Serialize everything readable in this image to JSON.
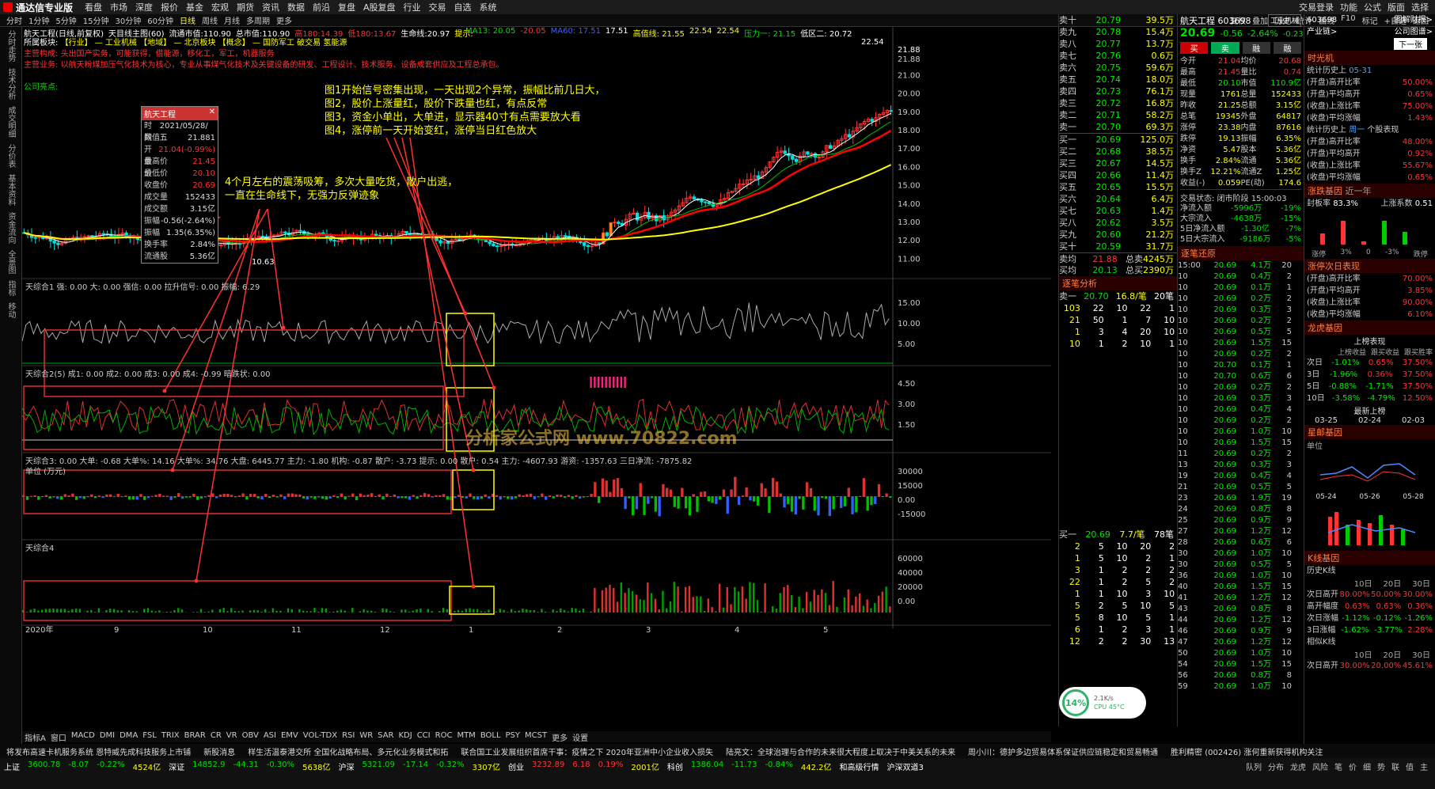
{
  "window": {
    "app_name": "通达信专业版",
    "menu": [
      "看盘",
      "市场",
      "深度",
      "报价",
      "基金",
      "宏观",
      "期货",
      "资讯",
      "数据",
      "前沿",
      "复盘",
      "A股复盘",
      "行业",
      "交易",
      "自选",
      "系统"
    ],
    "right_items": [
      "交易登录",
      "功能",
      "公式",
      "版面",
      "选择"
    ]
  },
  "toolbar": {
    "periods": [
      "分时",
      "1分钟",
      "5分钟",
      "15分钟",
      "30分钟",
      "60分钟",
      "日线",
      "周线",
      "月线",
      "多周期",
      "更多"
    ],
    "right_buttons": [
      "复权",
      "叠加",
      "历史",
      "统计",
      "画线",
      "F10",
      "标记",
      "+自选",
      "返回"
    ]
  },
  "leftbar": [
    "分时走势",
    "技术分析",
    "成交明细",
    "分价表",
    "基本资料",
    "资金流向",
    "全景图",
    "指标",
    "移动"
  ],
  "chart_header": {
    "title": "航天工程(日线,前复权)",
    "ma_line": "天目线主图(60)",
    "circ": "流通市值:110.90",
    "total": "总市值:110.90",
    "high": "高180:14.39",
    "low": "低180:13.67",
    "life": "生命线:20.97",
    "hint": "提示:",
    "ma13": "MA13: 20.05",
    "ma20": "-20.05",
    "ma60": "MA60: 17.51",
    "ma5": "17.51",
    "hi2": "高值线: 21.55",
    "v2": "22.54",
    "v3": "22.54",
    "small1": "压力一: 21.15",
    "small2": "低区二: 20.72"
  },
  "stock_info": {
    "sector_label": "所属板块:",
    "sector": "【行业】 — 工业机械   【地域】 — 北京板块   【概念】 — 国防军工 破交易 氢能源",
    "main_label": "主营构成:",
    "main": "头出国产实务，可能获得，借能源，移化工，军工，机器服务",
    "biz_label": "主营业务:",
    "biz": "以航天粉煤加压气化技术为核心，专业从事煤气化技术及关键设备的研发、工程设计、技术服务、设备成套供应及工程总承包。",
    "company_label": "公司亮点:"
  },
  "price_axis": [
    "21.88",
    "21.00",
    "20.00",
    "19.00",
    "18.00",
    "17.00",
    "16.00",
    "15.00",
    "14.00",
    "13.00",
    "12.00",
    "11.00"
  ],
  "top_right_price": "21.88",
  "max_label": "22.54",
  "low_label": "10.63",
  "popup": {
    "title": "航天工程",
    "rows": [
      [
        "时间",
        "2021/05/28/五"
      ],
      [
        "数值",
        "21.881"
      ],
      [
        "开盘价",
        "21.04(-0.99%)"
      ],
      [
        "最高价",
        "21.45"
      ],
      [
        "最低价",
        "20.10"
      ],
      [
        "收盘价",
        "20.69"
      ],
      [
        "成交量",
        "152433"
      ],
      [
        "成交额",
        "3.15亿"
      ],
      [
        "振幅",
        "-0.56(-2.64%)"
      ],
      [
        "振幅",
        "1.35(6.35%)"
      ],
      [
        "换手率",
        "2.84%"
      ],
      [
        "流通股",
        "5.36亿"
      ]
    ]
  },
  "annotations": {
    "a1": [
      "图1开始信号密集出现，一天出现2个异常，振幅比前几日大，",
      "图2，股价上涨量红，股价下跌量也红，有点反常",
      "图3，资金小单出，大单进，显示器40寸有点需要放大看",
      "图4，涨停前一天开始变红，涨停当日红色放大"
    ],
    "a2": [
      "4个月左右的震荡吸筹，多次大量吃货，散户出逃，",
      "一直在生命线下，无强力反弹迹象"
    ]
  },
  "panels": {
    "p1": {
      "hdr": "天综合1 强: 0.00  大: 0.00  强信: 0.00  拉升信号: 0.00  振幅: 6.29",
      "axis": [
        "15.00",
        "10.00",
        "5.00"
      ]
    },
    "p2": {
      "hdr": "天综合2(5) 成1: 0.00  成2: 0.00  成3: 0.00  成4: -0.99  暗跌状: 0.00",
      "axis": [
        "4.50",
        "3.00",
        "1.50"
      ]
    },
    "p3": {
      "hdr": "天综合3: 0.00  大单: -0.68  大单%: 14.16  大单%: 34.76  大盘: 6445.77  主力: -1.80  机构: -0.87  散户: -3.73  提示: 0.00  散户: 0.54  主力: -4607.93  游资: -1357.63  三日净流: -7875.82",
      "unit": "单位 (万元)",
      "axis": [
        "30000",
        "15000",
        "0.00",
        "-15000"
      ]
    },
    "p4": {
      "hdr": "天综合4",
      "axis": [
        "60000",
        "40000",
        "20000",
        "0.00"
      ]
    }
  },
  "xaxis": [
    "2020年",
    "9",
    "10",
    "11",
    "12",
    "1",
    "2",
    "3",
    "4",
    "5"
  ],
  "bottom_tabs": [
    "指标A",
    "窗口",
    "MACD",
    "DMI",
    "DMA",
    "FSL",
    "TRIX",
    "BRAR",
    "CR",
    "VR",
    "OBV",
    "ASI",
    "EMV",
    "VOL-TDX",
    "RSI",
    "WR",
    "SAR",
    "KDJ",
    "CCI",
    "ROC",
    "MTM",
    "BOLL",
    "PSY",
    "MCST",
    "更多",
    "设置"
  ],
  "watermark": "分析家公式网 www.70822.com",
  "quote": {
    "sells": [
      [
        "卖十",
        "20.79",
        "39.5万"
      ],
      [
        "卖九",
        "20.78",
        "15.4万"
      ],
      [
        "卖八",
        "20.77",
        "13.7万"
      ],
      [
        "卖七",
        "20.76",
        "0.6万"
      ],
      [
        "卖六",
        "20.75",
        "59.6万"
      ],
      [
        "卖五",
        "20.74",
        "18.0万"
      ],
      [
        "卖四",
        "20.73",
        "76.1万"
      ],
      [
        "卖三",
        "20.72",
        "16.8万"
      ],
      [
        "卖二",
        "20.71",
        "58.2万"
      ],
      [
        "卖一",
        "20.70",
        "69.3万"
      ]
    ],
    "buys": [
      [
        "买一",
        "20.69",
        "125.0万"
      ],
      [
        "买二",
        "20.68",
        "38.5万"
      ],
      [
        "买三",
        "20.67",
        "14.5万"
      ],
      [
        "买四",
        "20.66",
        "11.4万"
      ],
      [
        "买五",
        "20.65",
        "15.5万"
      ],
      [
        "买六",
        "20.64",
        "6.4万"
      ],
      [
        "买七",
        "20.63",
        "1.4万"
      ],
      [
        "买八",
        "20.62",
        "3.5万"
      ],
      [
        "买九",
        "20.60",
        "21.2万"
      ],
      [
        "买十",
        "20.59",
        "31.7万"
      ]
    ],
    "avg_sell": [
      "卖均",
      "21.88",
      "总卖",
      "4245万"
    ],
    "avg_buy": [
      "买均",
      "20.13",
      "总买",
      "2390万"
    ],
    "sep_title": "逐笔分析",
    "sell1": [
      "卖一",
      "20.70",
      "16.8/笔",
      "20笔"
    ],
    "grid1": [
      [
        "103",
        "22",
        "10",
        "22",
        "1"
      ],
      [
        "21",
        "50",
        "1",
        "7",
        "10"
      ],
      [
        "1",
        "3",
        "4",
        "20",
        "10"
      ],
      [
        "10",
        "1",
        "2",
        "10",
        "1"
      ]
    ],
    "buy1": [
      "买一",
      "20.69",
      "7.7/笔",
      "78笔"
    ],
    "grid2": [
      [
        "2",
        "5",
        "10",
        "20",
        "2"
      ],
      [
        "1",
        "5",
        "10",
        "2",
        "1"
      ],
      [
        "3",
        "1",
        "2",
        "2",
        "2"
      ],
      [
        "22",
        "1",
        "2",
        "5",
        "2"
      ],
      [
        "1",
        "1",
        "10",
        "3",
        "10"
      ],
      [
        "5",
        "2",
        "5",
        "10",
        "5"
      ],
      [
        "5",
        "8",
        "10",
        "5",
        "1"
      ],
      [
        "6",
        "1",
        "2",
        "3",
        "1"
      ],
      [
        "12",
        "2",
        "2",
        "30",
        "13"
      ]
    ]
  },
  "ticks": {
    "title": "逐笔还原",
    "rows": [
      [
        "15:00",
        "20.69",
        "4.1万",
        "20"
      ],
      [
        "10",
        "20.69",
        "0.4万",
        "2"
      ],
      [
        "10",
        "20.69",
        "0.1万",
        "1"
      ],
      [
        "10",
        "20.69",
        "0.2万",
        "2"
      ],
      [
        "10",
        "20.69",
        "0.3万",
        "3"
      ],
      [
        "10",
        "20.69",
        "0.2万",
        "2"
      ],
      [
        "10",
        "20.69",
        "0.5万",
        "5"
      ],
      [
        "10",
        "20.69",
        "1.5万",
        "15"
      ],
      [
        "10",
        "20.69",
        "0.2万",
        "2"
      ],
      [
        "10",
        "20.70",
        "0.1万",
        "1"
      ],
      [
        "10",
        "20.70",
        "0.6万",
        "6"
      ],
      [
        "10",
        "20.69",
        "0.2万",
        "2"
      ],
      [
        "10",
        "20.69",
        "0.3万",
        "3"
      ],
      [
        "10",
        "20.69",
        "0.4万",
        "4"
      ],
      [
        "10",
        "20.69",
        "0.2万",
        "2"
      ],
      [
        "10",
        "20.69",
        "1.0万",
        "10"
      ],
      [
        "10",
        "20.69",
        "1.5万",
        "15"
      ],
      [
        "11",
        "20.69",
        "0.2万",
        "2"
      ],
      [
        "13",
        "20.69",
        "0.3万",
        "3"
      ],
      [
        "19",
        "20.69",
        "0.4万",
        "4"
      ],
      [
        "21",
        "20.69",
        "0.5万",
        "5"
      ],
      [
        "23",
        "20.69",
        "1.9万",
        "19"
      ],
      [
        "24",
        "20.69",
        "0.8万",
        "8"
      ],
      [
        "25",
        "20.69",
        "0.9万",
        "9"
      ],
      [
        "27",
        "20.69",
        "1.2万",
        "12"
      ],
      [
        "28",
        "20.69",
        "0.6万",
        "6"
      ],
      [
        "30",
        "20.69",
        "1.0万",
        "10"
      ],
      [
        "30",
        "20.69",
        "0.5万",
        "5"
      ],
      [
        "36",
        "20.69",
        "1.0万",
        "10"
      ],
      [
        "40",
        "20.69",
        "1.5万",
        "15"
      ],
      [
        "41",
        "20.69",
        "1.2万",
        "12"
      ],
      [
        "43",
        "20.69",
        "0.8万",
        "8"
      ],
      [
        "44",
        "20.69",
        "1.2万",
        "12"
      ],
      [
        "46",
        "20.69",
        "0.9万",
        "9"
      ],
      [
        "47",
        "20.69",
        "1.2万",
        "12"
      ],
      [
        "50",
        "20.69",
        "1.0万",
        "10"
      ],
      [
        "54",
        "20.69",
        "1.5万",
        "15"
      ],
      [
        "56",
        "20.69",
        "0.8万",
        "8"
      ],
      [
        "59",
        "20.69",
        "1.0万",
        "10"
      ]
    ]
  },
  "stockpanel": {
    "name": "航天工程 603698",
    "badge": "工业机械",
    "price": "20.69",
    "chg": "-0.56",
    "pct": "-2.64%",
    "pct2": "-0.23%",
    "btns": [
      "买",
      "卖",
      "融",
      "融"
    ],
    "rows": [
      [
        "今开",
        "21.04",
        "均价",
        "20.68"
      ],
      [
        "最高",
        "21.45",
        "量比",
        "0.74"
      ],
      [
        "最低",
        "20.10",
        "市值",
        "110.9亿"
      ],
      [
        "现量",
        "1761",
        "总量",
        "152433"
      ],
      [
        "昨收",
        "21.25",
        "总额",
        "3.15亿"
      ],
      [
        "总笔",
        "19345",
        "外盘",
        "64817"
      ],
      [
        "涨停",
        "23.38",
        "内盘",
        "87616"
      ],
      [
        "跌停",
        "19.13",
        "振幅",
        "6.35%"
      ],
      [
        "净资",
        "5.47",
        "股本",
        "5.36亿"
      ],
      [
        "换手",
        "2.84%",
        "流通",
        "5.36亿"
      ],
      [
        "换手Z",
        "12.21%",
        "流通Z",
        "1.25亿"
      ],
      [
        "收益(-)",
        "0.059",
        "PE(动)",
        "174.6"
      ]
    ],
    "status": "交易状态: 闭市阶段 15:00:03",
    "flows": [
      [
        "净流入额",
        "-5996万",
        "-19%"
      ],
      [
        "大宗流入",
        "-4638万",
        "-15%"
      ],
      [
        "5日净流入额",
        "-1.30亿",
        "-7%"
      ],
      [
        "5日大宗流入",
        "-9186万",
        "-5%"
      ]
    ]
  },
  "farright": {
    "code": "603698",
    "title1": "图解财报>",
    "title2": "公司图谱>",
    "industry": "产业链>",
    "next": "下一张",
    "sec1": "时光机",
    "hist_label": "统计历史上",
    "hist_date": "05-31",
    "rows1": [
      [
        "(开盘)高开比率",
        "50.00%"
      ],
      [
        "(开盘)平均高开",
        "0.65%"
      ],
      [
        "(收盘)上涨比率",
        "75.00%"
      ],
      [
        "(收盘)平均涨幅",
        "1.43%"
      ]
    ],
    "hist2_label": "统计历史上",
    "hist2_date": "周一",
    "hist2_tail": "个股表现",
    "rows2": [
      [
        "(开盘)高开比率",
        "48.00%"
      ],
      [
        "(开盘)平均高开",
        "0.92%"
      ],
      [
        "(收盘)上涨比率",
        "55.67%"
      ],
      [
        "(收盘)平均涨幅",
        "0.65%"
      ]
    ],
    "sec2": "涨跌基因",
    "near": "近一年",
    "fengban": "封板率",
    "fengban_v": "83.3%",
    "up_label": "上涨系数",
    "up_v": "0.51",
    "bars_labels": [
      "涨停",
      "3%",
      "0",
      "-3%",
      "跌停"
    ],
    "sec3": "涨停次日表现",
    "rows3": [
      [
        "(开盘)高开比率",
        "70.00%"
      ],
      [
        "(开盘)平均高开",
        "3.85%"
      ],
      [
        "(收盘)上涨比率",
        "90.00%"
      ],
      [
        "(收盘)平均涨幅",
        "6.10%"
      ]
    ],
    "sec4": "龙虎基因",
    "lhb_title": "上榜表现",
    "lhb_hdr": [
      "上榜收益",
      "跟买收益",
      "跟买胜率"
    ],
    "lhb_rows": [
      [
        "次日",
        "-1.01%",
        "0.65%",
        "37.50%"
      ],
      [
        "3日",
        "-1.96%",
        "0.36%",
        "37.50%"
      ],
      [
        "5日",
        "-0.88%",
        "-1.71%",
        "37.50%"
      ],
      [
        "10日",
        "-3.58%",
        "-4.79%",
        "12.50%"
      ]
    ],
    "latest": "最新上榜",
    "dates": [
      "03-25",
      "02-24",
      "02-03"
    ],
    "sec5": "星邮基因",
    "unit": "单位",
    "dates2": [
      "05-24",
      "05-26",
      "05-28"
    ],
    "sec6": "K线基因",
    "kline_hist": "历史K线",
    "kline_hdr": [
      "10日",
      "20日",
      "30日"
    ],
    "kline_rows": [
      [
        "次日高开",
        "80.00%",
        "50.00%",
        "30.00%"
      ],
      [
        "高开幅度",
        "0.63%",
        "0.63%",
        "0.36%"
      ],
      [
        "次日涨幅",
        "-1.12%",
        "-0.12%",
        "-1.26%"
      ],
      [
        "3日涨幅",
        "-1.62%",
        "-3.77%",
        "2.28%"
      ]
    ],
    "similar": "相似K线",
    "sim_hdr": [
      "10日",
      "20日",
      "30日"
    ],
    "sim_row": [
      "次日高开",
      "30.00%",
      "20.00%",
      "45.61%"
    ]
  },
  "news": [
    "将发布高速卡机服务系统 恩特威先成科技服务上市铺",
    "新股消息",
    "样生活温泰港交所 全国化战略布局、多元化业务模式和拓",
    "联合国工业发展组织首席干事：疫情之下 2020年亚洲中小企业收入损失",
    "陆亮文：全球治理与合作的未来很大程度上取决于中美关系的未来",
    "周小川：德护多边贸易体系保证供应链稳定和贸易畅通",
    "胜利精密 (002426) 涨何重新获得机构关注"
  ],
  "statusbar": {
    "sh": "上证",
    "sh_v": "3600.78",
    "sh_c": "-8.07",
    "sh_p": "-0.22%",
    "sh_a": "4524亿",
    "sz": "深证",
    "sz_v": "14852.9",
    "sz_c": "-44.31",
    "sz_p": "-0.30%",
    "sz_a": "5638亿",
    "hs": "沪深",
    "hs_v": "5321.09",
    "hs_c": "-17.14",
    "hs_p": "-0.32%",
    "hs_a": "3307亿",
    "cy": "创业",
    "cy_v": "3232.89",
    "cy_c": "6.18",
    "cy_p": "0.19%",
    "cy_a": "2001亿",
    "kc": "科创",
    "kc_v": "1386.04",
    "kc_c": "-11.73",
    "kc_p": "-0.84%",
    "kc_a": "442.2亿",
    "tail": "沪深双道3",
    "tail2": "和高级行情"
  },
  "bottom_right_tabs": [
    "队列",
    "分布",
    "龙虎",
    "风险",
    "笔",
    "价",
    "细",
    "势",
    "联",
    "值",
    "主"
  ],
  "widget": {
    "pct": "14%",
    "speed": "2.1K/s",
    "cpu": "CPU 45°C"
  },
  "colors": {
    "up": "#ff3333",
    "down": "#00e0e0",
    "ma_red": "#ff0000",
    "ma_yellow": "#ffff00",
    "life": "#ffffff",
    "annot": "#ffff00"
  }
}
